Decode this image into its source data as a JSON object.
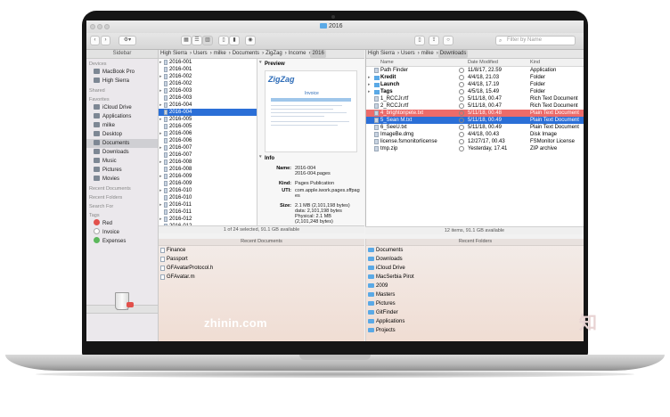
{
  "window": {
    "title": "2016"
  },
  "toolbar": {
    "search_placeholder": "Filter by Name",
    "sidebar_label": "Sidebar"
  },
  "sidebar": {
    "devices_header": "Devices",
    "devices": [
      "MacBook Pro",
      "High Sierra"
    ],
    "shared_header": "Shared",
    "favorites_header": "Favorites",
    "favorites": [
      "iCloud Drive",
      "Applications",
      "milke",
      "Desktop",
      "Documents",
      "Downloads",
      "Music",
      "Pictures",
      "Movies"
    ],
    "recent_docs_header": "Recent Documents",
    "recent_folders_header": "Recent Folders",
    "search_for_header": "Search For",
    "tags_header": "Tags",
    "tags": [
      {
        "label": "Red",
        "color": "#e2504b"
      },
      {
        "label": "Invoice",
        "color": "#ffffff"
      },
      {
        "label": "Expenses",
        "color": "#5cb85c"
      }
    ],
    "trash_label": "Trash"
  },
  "left_pane": {
    "path": [
      "High Sierra",
      "Users",
      "milke",
      "Documents",
      "ZigZag",
      "Income",
      "2016"
    ],
    "files": [
      "2016-001",
      "2016-001",
      "2016-002",
      "2016-002",
      "2016-003",
      "2016-003",
      "2016-004",
      "2016-004",
      "2016-005",
      "2016-005",
      "2016-006",
      "2016-006",
      "2016-007",
      "2016-007",
      "2016-008",
      "2016-008",
      "2016-009",
      "2016-009",
      "2016-010",
      "2016-010",
      "2016-011",
      "2016-011",
      "2016-012",
      "2016-012"
    ],
    "selected_index": 7,
    "status": "1 of 24 selected, 91.1 GB available"
  },
  "preview": {
    "preview_header": "Preview",
    "logo_text": "ZigZag",
    "doc_title": "Invoice",
    "info_header": "Info",
    "info": [
      {
        "key": "Name:",
        "value": "2016-004\n2016-004.pages"
      },
      {
        "key": "Kind:",
        "value": "Pages Publication"
      },
      {
        "key": "UTI:",
        "value": "com.apple.iwork.pages.sffpages"
      },
      {
        "key": "Size:",
        "value": "2.1 MB (2,101,198 bytes)\ndata: 2,101,198 bytes\nPhysical: 2.1 MB\n(2,101,248 bytes)"
      }
    ]
  },
  "right_pane": {
    "path": [
      "High Sierra",
      "Users",
      "milke",
      "Downloads"
    ],
    "columns": [
      "Name",
      "Date Modified",
      "Kind"
    ],
    "rows": [
      {
        "name": "Path Finder",
        "date": "11/8/17, 22.59",
        "kind": "Application",
        "style": ""
      },
      {
        "name": "Kredit",
        "date": "4/4/18, 21.03",
        "kind": "Folder",
        "style": "",
        "bold": true
      },
      {
        "name": "Launch",
        "date": "4/4/18, 17.19",
        "kind": "Folder",
        "style": "",
        "bold": true
      },
      {
        "name": "Tags",
        "date": "4/5/18, 15.49",
        "kind": "Folder",
        "style": "",
        "bold": true
      },
      {
        "name": "1_RCCJr.rtf",
        "date": "5/11/18, 00.47",
        "kind": "Rich Text Document",
        "style": ""
      },
      {
        "name": "2_RCCJr.rtf",
        "date": "5/11/18, 00.47",
        "kind": "Rich Text Document",
        "style": ""
      },
      {
        "name": "4_brightonpete.txt",
        "date": "5/11/18, 00.48",
        "kind": "Plain Text Document",
        "style": "red"
      },
      {
        "name": "5_Sean M.txt",
        "date": "5/11/18, 00.49",
        "kind": "Plain Text Document",
        "style": "blue"
      },
      {
        "name": "6_SeeU.txt",
        "date": "5/11/18, 00.49",
        "kind": "Plain Text Document",
        "style": ""
      },
      {
        "name": "ImageBe.dmg",
        "date": "4/4/18, 00.43",
        "kind": "Disk Image",
        "style": ""
      },
      {
        "name": "license.fsmonitorlicense",
        "date": "12/27/17, 00.43",
        "kind": "FSMonitor License",
        "style": ""
      },
      {
        "name": "tmp.zip",
        "date": "Yesterday, 17.41",
        "kind": "ZIP archive",
        "style": ""
      }
    ],
    "status": "12 items, 91.1 GB available"
  },
  "recent_documents": {
    "header": "Recent Documents",
    "items": [
      "Finance",
      "Passport",
      "GFAvatarProtocol.h",
      "GFAvatar.m"
    ]
  },
  "recent_folders": {
    "header": "Recent Folders",
    "items": [
      "Documents",
      "Downloads",
      "iCloud Drive",
      "MacSerbia Pirot",
      "2009",
      "Masters",
      "Pictures",
      "GitFinder",
      "Applications",
      "Projects"
    ]
  },
  "watermark": {
    "text": "zhinin.com",
    "logo": "知"
  }
}
